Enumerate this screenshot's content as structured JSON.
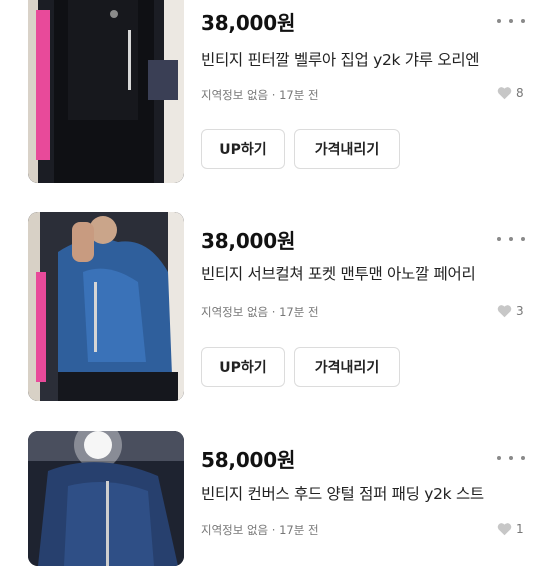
{
  "listings": [
    {
      "price": "38,000원",
      "title": "빈티지 핀터깔 벨루아 집업 y2k 갸루 오리엔",
      "meta": "지역정보 없음 · 17분 전",
      "likes": "8",
      "up_label": "UP하기",
      "price_down_label": "가격내리기"
    },
    {
      "price": "38,000원",
      "title": "빈티지 서브컬쳐 포켓 맨투맨 아노깔 페어리",
      "meta": "지역정보 없음 · 17분 전",
      "likes": "3",
      "up_label": "UP하기",
      "price_down_label": "가격내리기"
    },
    {
      "price": "58,000원",
      "title": "빈티지 컨버스 후드 양털 점퍼 패딩 y2k 스트",
      "meta": "지역정보 없음 · 17분 전",
      "likes": "1"
    }
  ],
  "icons": {
    "more": "more-dots-icon",
    "like": "heart-icon"
  },
  "colors": {
    "text": "#111111",
    "muted": "#777777",
    "border": "#dcdcdc",
    "icon": "#b5b5b5"
  }
}
